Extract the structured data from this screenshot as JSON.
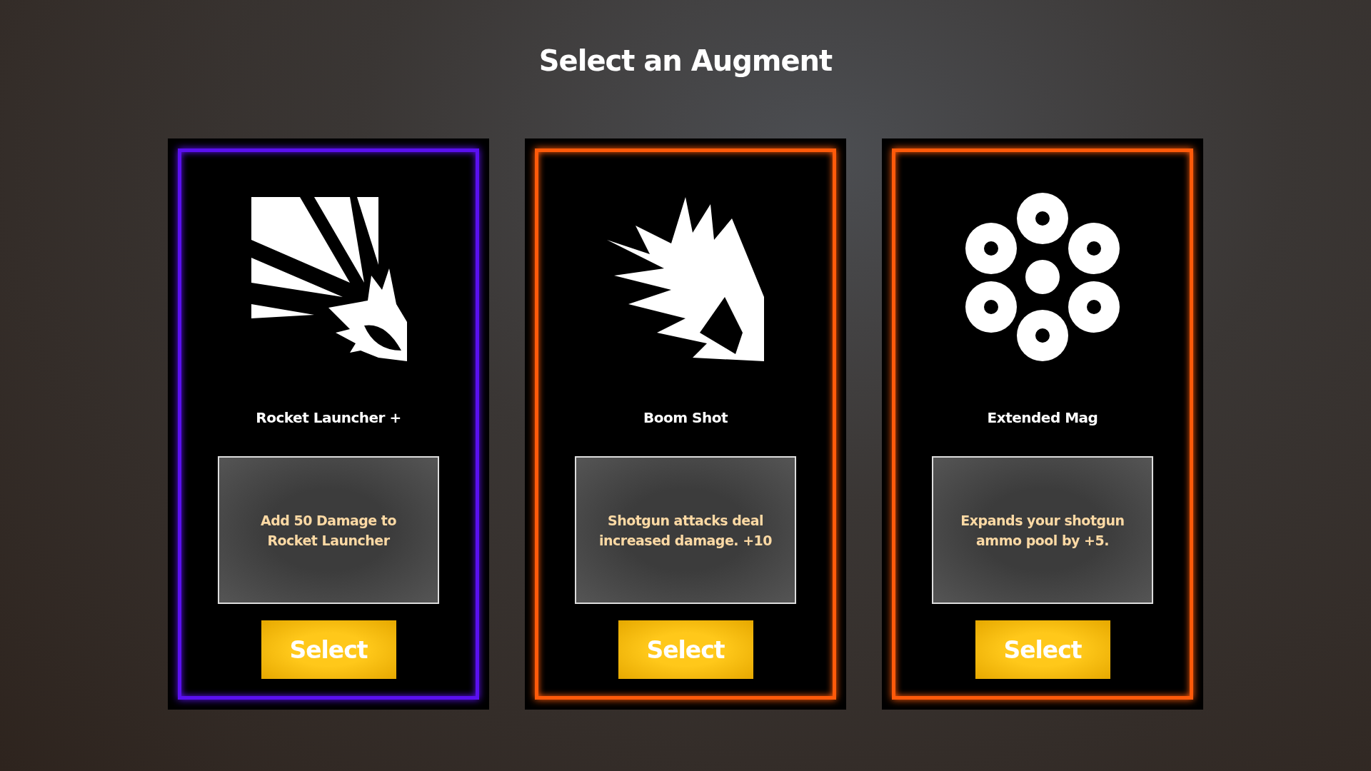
{
  "title": "Select an Augment",
  "cards": [
    {
      "name": "Rocket Launcher +",
      "description": "Add 50 Damage to Rocket Launcher",
      "button": "Select",
      "color": "#5a10f0"
    },
    {
      "name": "Boom Shot",
      "description": "Shotgun attacks deal increased damage. +10",
      "button": "Select",
      "color": "#ff5a0a"
    },
    {
      "name": "Extended Mag",
      "description": "Expands your shotgun ammo pool by +5.",
      "button": "Select",
      "color": "#ff5a0a"
    }
  ]
}
